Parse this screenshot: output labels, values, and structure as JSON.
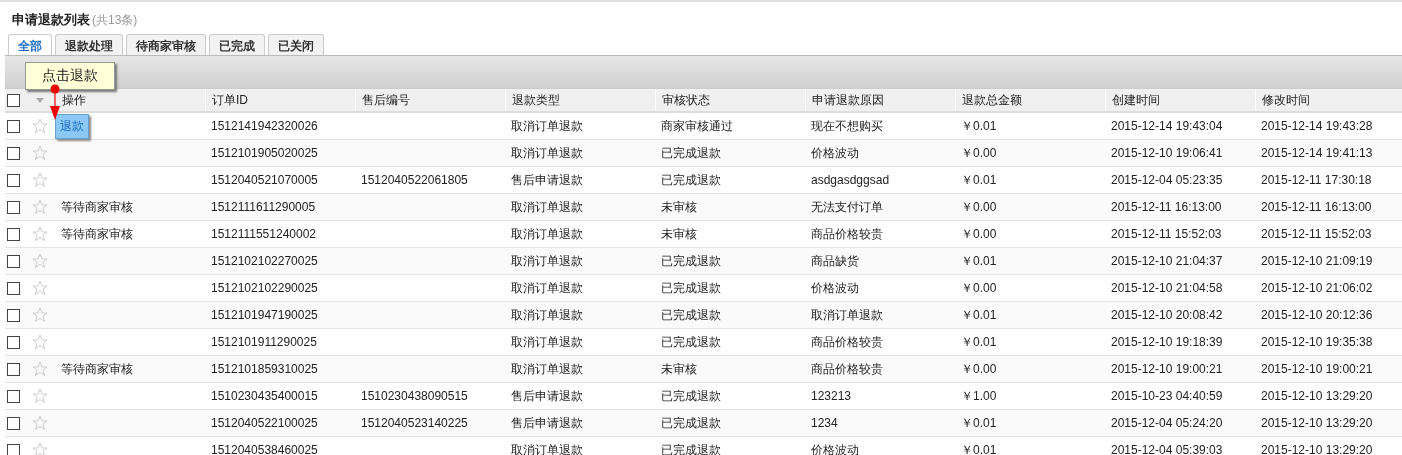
{
  "header": {
    "title": "申请退款列表",
    "count": "(共13条)"
  },
  "tabs": [
    {
      "label": "全部",
      "selected": true
    },
    {
      "label": "退款处理",
      "selected": false
    },
    {
      "label": "待商家审核",
      "selected": false
    },
    {
      "label": "已完成",
      "selected": false
    },
    {
      "label": "已关闭",
      "selected": false
    }
  ],
  "callout": {
    "text": "点击退款"
  },
  "table": {
    "select_all": {
      "checked": false
    },
    "columns": [
      "操作",
      "订单ID",
      "售后编号",
      "退款类型",
      "审核状态",
      "申请退款原因",
      "退款总金额",
      "创建时间",
      "修改时间"
    ],
    "rows": [
      {
        "checked": false,
        "kind": "button",
        "cells": [
          "退款",
          "1512141942320026",
          "",
          "取消订单退款",
          "商家审核通过",
          "现在不想购买",
          "￥0.01",
          "2015-12-14 19:43:04",
          "2015-12-14 19:43:28"
        ]
      },
      {
        "checked": false,
        "cells": [
          "",
          "1512101905020025",
          "",
          "取消订单退款",
          "已完成退款",
          "价格波动",
          "￥0.00",
          "2015-12-10 19:06:41",
          "2015-12-14 19:41:13"
        ]
      },
      {
        "checked": false,
        "cells": [
          "",
          "1512040521070005",
          "1512040522061805",
          "售后申请退款",
          "已完成退款",
          "asdgasdggsad",
          "￥0.01",
          "2015-12-04 05:23:35",
          "2015-12-11 17:30:18"
        ]
      },
      {
        "checked": false,
        "kind": "text",
        "cells": [
          "等待商家审核",
          "1512111611290005",
          "",
          "取消订单退款",
          "未审核",
          "无法支付订单",
          "￥0.00",
          "2015-12-11 16:13:00",
          "2015-12-11 16:13:00"
        ]
      },
      {
        "checked": false,
        "kind": "text",
        "cells": [
          "等待商家审核",
          "1512111551240002",
          "",
          "取消订单退款",
          "未审核",
          "商品价格较贵",
          "￥0.00",
          "2015-12-11 15:52:03",
          "2015-12-11 15:52:03"
        ]
      },
      {
        "checked": false,
        "cells": [
          "",
          "1512102102270025",
          "",
          "取消订单退款",
          "已完成退款",
          "商品缺货",
          "￥0.01",
          "2015-12-10 21:04:37",
          "2015-12-10 21:09:19"
        ]
      },
      {
        "checked": false,
        "cells": [
          "",
          "1512102102290025",
          "",
          "取消订单退款",
          "已完成退款",
          "价格波动",
          "￥0.00",
          "2015-12-10 21:04:58",
          "2015-12-10 21:06:02"
        ]
      },
      {
        "checked": false,
        "cells": [
          "",
          "1512101947190025",
          "",
          "取消订单退款",
          "已完成退款",
          "取消订单退款",
          "￥0.01",
          "2015-12-10 20:08:42",
          "2015-12-10 20:12:36"
        ]
      },
      {
        "checked": false,
        "cells": [
          "",
          "1512101911290025",
          "",
          "取消订单退款",
          "已完成退款",
          "商品价格较贵",
          "￥0.01",
          "2015-12-10 19:18:39",
          "2015-12-10 19:35:38"
        ]
      },
      {
        "checked": false,
        "kind": "text",
        "cells": [
          "等待商家审核",
          "1512101859310025",
          "",
          "取消订单退款",
          "未审核",
          "商品价格较贵",
          "￥0.00",
          "2015-12-10 19:00:21",
          "2015-12-10 19:00:21"
        ]
      },
      {
        "checked": false,
        "cells": [
          "",
          "1510230435400015",
          "1510230438090515",
          "售后申请退款",
          "已完成退款",
          "123213",
          "￥1.00",
          "2015-10-23 04:40:59",
          "2015-12-10 13:29:20"
        ]
      },
      {
        "checked": false,
        "cells": [
          "",
          "1512040522100025",
          "1512040523140225",
          "售后申请退款",
          "已完成退款",
          "1234",
          "￥0.01",
          "2015-12-04 05:24:20",
          "2015-12-10 13:29:20"
        ]
      },
      {
        "checked": false,
        "cells": [
          "",
          "1512040538460025",
          "",
          "取消订单退款",
          "已完成退款",
          "价格波动",
          "￥0.01",
          "2015-12-04 05:39:03",
          "2015-12-10 13:29:20"
        ]
      }
    ]
  }
}
